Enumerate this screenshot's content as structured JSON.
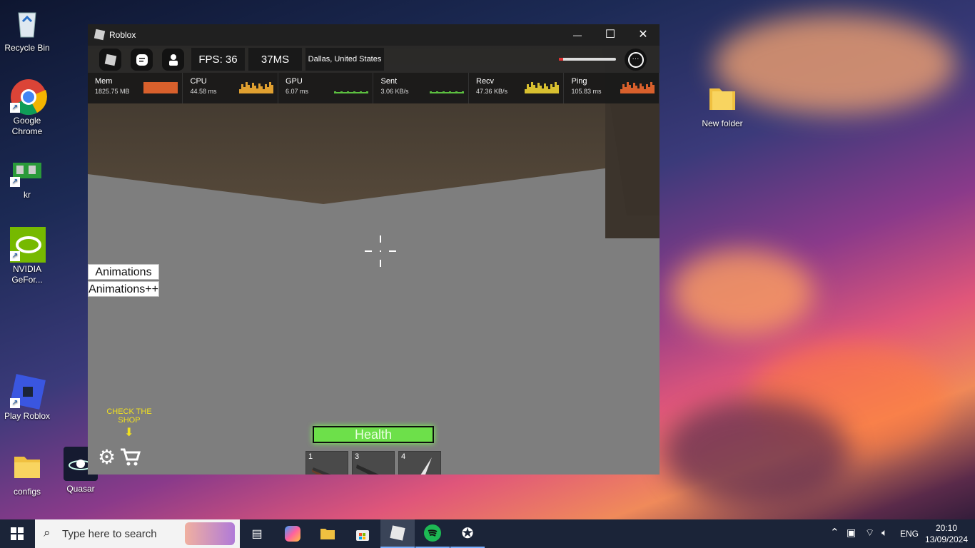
{
  "desktop": {
    "icons": [
      {
        "label": "Recycle Bin",
        "icon": "recycle-bin-icon"
      },
      {
        "label": "Google Chrome",
        "icon": "chrome-icon"
      },
      {
        "label": "kr",
        "icon": "ram-icon"
      },
      {
        "label": "NVIDIA GeFor...",
        "icon": "nvidia-icon"
      },
      {
        "label": "Play Roblox",
        "icon": "roblox-studio-icon"
      },
      {
        "label": "configs",
        "icon": "folder-icon"
      },
      {
        "label": "Quasar",
        "icon": "quasar-icon"
      },
      {
        "label": "New folder",
        "icon": "folder-icon"
      }
    ]
  },
  "window": {
    "title": "Roblox",
    "minimize": "—",
    "maximize": "☐",
    "close": "✕"
  },
  "game": {
    "topbar": {
      "fps": "FPS: 36",
      "ping": "37MS",
      "location": "Dallas, United States",
      "more": "···"
    },
    "stats": [
      {
        "name": "Mem",
        "value": "1825.75 MB",
        "color": "#d8602c"
      },
      {
        "name": "CPU",
        "value": "44.58 ms",
        "color": "#e0a030"
      },
      {
        "name": "GPU",
        "value": "6.07 ms",
        "color": "#5cc040"
      },
      {
        "name": "Sent",
        "value": "3.06 KB/s",
        "color": "#5cc040"
      },
      {
        "name": "Recv",
        "value": "47.36 KB/s",
        "color": "#d8c030"
      },
      {
        "name": "Ping",
        "value": "105.83 ms",
        "color": "#d8602c"
      }
    ],
    "animations_button": "Animations",
    "animations_plus_button": "Animations++",
    "shop_hint": "CHECK THE SHOP",
    "health_label": "Health",
    "health_fraction": 1.0,
    "hotbar": [
      {
        "slot": "1",
        "item": "revolver-icon"
      },
      {
        "slot": "3",
        "item": "shotgun-icon"
      },
      {
        "slot": "4",
        "item": "knife-icon"
      }
    ]
  },
  "taskbar": {
    "search_placeholder": "Type here to search",
    "language": "ENG",
    "time": "20:10",
    "date": "13/09/2024"
  }
}
